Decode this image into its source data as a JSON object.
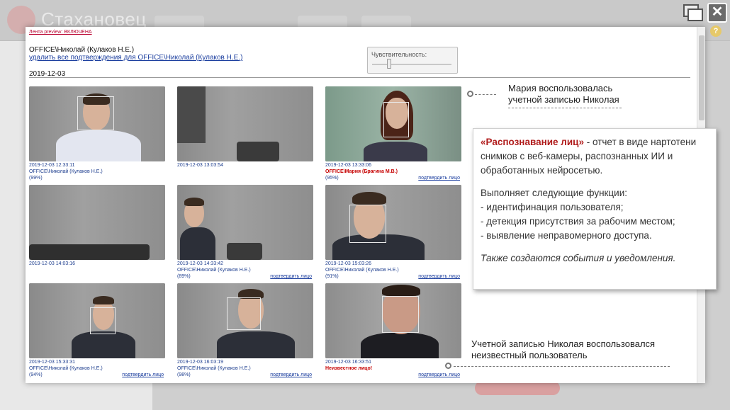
{
  "background": {
    "brand": "Стахановец",
    "help_label": "?"
  },
  "window_controls": {
    "close_label": "✕"
  },
  "report": {
    "preview_link": "Лента preview: ВКЛЮЧЕНА",
    "user_line": "OFFICE\\Николай (Кулаков Н.Е.)",
    "delete_link": "удалить все подтверждения для OFFICE\\Николай (Кулаков Н.Е.)",
    "date_heading": "2019-12-03",
    "sensitivity_label": "Чувствительность:",
    "sensitivity_level": 0.2,
    "cards": [
      {
        "time": "2019-12-03 12:33:11",
        "user": "OFFICE\\Николай (Кулаков Н.Е.)",
        "conf": "(99%)",
        "confirm": ""
      },
      {
        "time": "2019-12-03 13:03:54",
        "user": "",
        "conf": "",
        "confirm": ""
      },
      {
        "time": "2019-12-03 13:33:06",
        "user": "OFFICE\\Мария (Брагина М.В.)",
        "conf": "(95%)",
        "confirm": "подтвердить лицо"
      },
      {
        "time": "2019-12-03 14:03:16",
        "user": "",
        "conf": "",
        "confirm": ""
      },
      {
        "time": "2019-12-03 14:33:42",
        "user": "OFFICE\\Николай (Кулаков Н.Е.)",
        "conf": "(89%)",
        "confirm": "подтвердить лицо"
      },
      {
        "time": "2019-12-03 15:03:26",
        "user": "OFFICE\\Николай (Кулаков Н.Е.)",
        "conf": "(91%)",
        "confirm": "подтвердить лицо"
      },
      {
        "time": "2019-12-03 15:33:31",
        "user": "OFFICE\\Николай (Кулаков Н.Е.)",
        "conf": "(94%)",
        "confirm": "подтвердить лицо"
      },
      {
        "time": "2019-12-03 16:03:19",
        "user": "OFFICE\\Николай (Кулаков Н.Е.)",
        "conf": "(98%)",
        "confirm": "подтвердить лицо"
      },
      {
        "time": "2019-12-03 16:33:51",
        "user": "Неизвестное лицо!",
        "conf": "",
        "confirm": "подтвердить лицо"
      }
    ]
  },
  "annotations": {
    "maria": "Мария воспользовалась учетной записью Николая",
    "unknown": "Учетной записью Николая воспользовался неизвестный пользователь"
  },
  "info_card": {
    "title": "«Распознавание лиц»",
    "intro_rest": " - отчет в виде нартотени снимков с веб-камеры, распознанных ИИ и обработанных нейросетью.",
    "functions_head": "Выполняет следующие функции:",
    "functions": [
      "- идентифинация пользователя;",
      "- детекция присутствия за рабочим местом;",
      "- выявление неправомерного доступа."
    ],
    "final": "Также создаются события и уведомления."
  },
  "colors": {
    "accent_red": "#b01b1b",
    "link_blue": "#1a3d9e"
  }
}
